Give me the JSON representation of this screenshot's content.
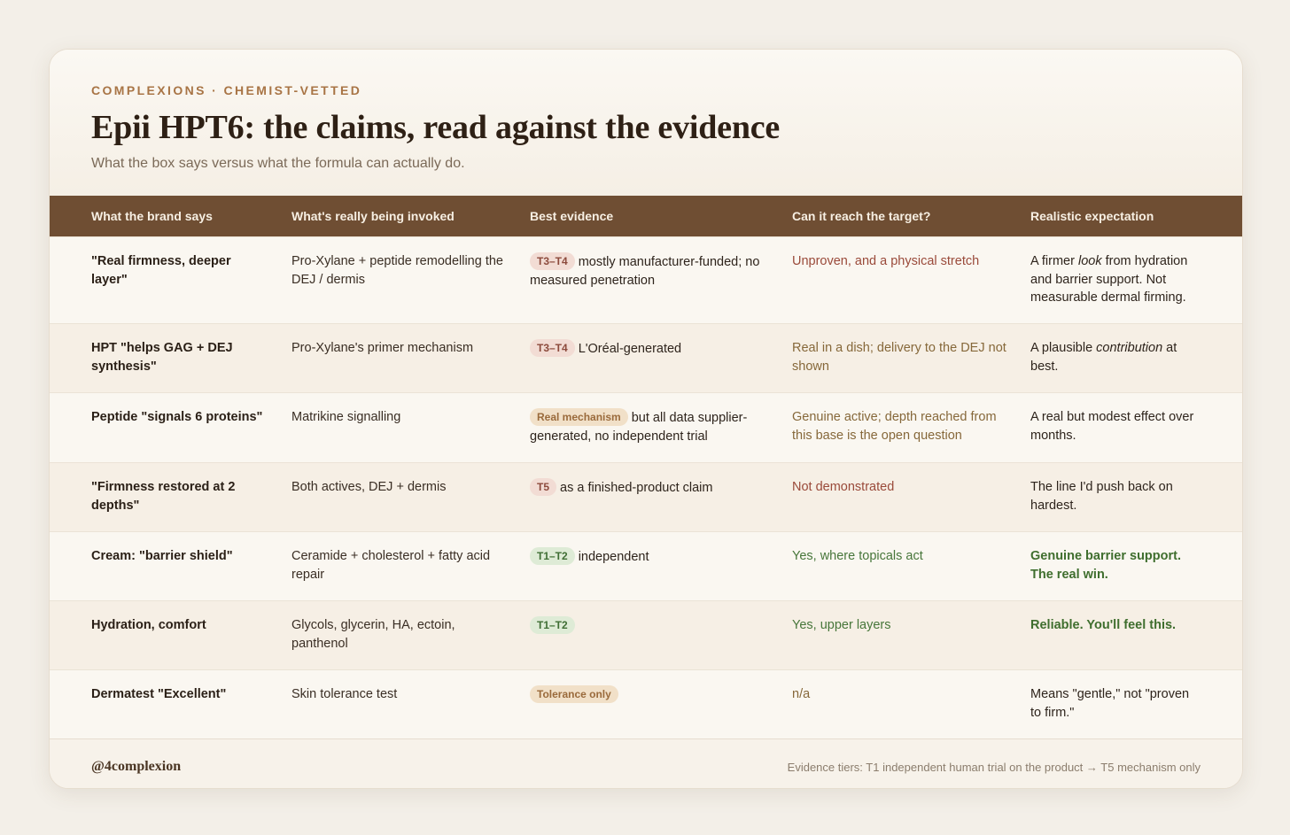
{
  "header": {
    "eyebrow": "COMPLEXIONS · CHEMIST-VETTED",
    "title": "Epii HPT6: the claims, read against the evidence",
    "subtitle": "What the box says versus what the formula can actually do."
  },
  "columns": [
    "What the brand says",
    "What's really being invoked",
    "Best evidence",
    "Can it reach the target?",
    "Realistic expectation"
  ],
  "rows": [
    {
      "claim": "\"Real firmness, deeper layer\"",
      "invoked": "Pro-Xylane + peptide remodelling the DEJ / dermis",
      "badge": "T3–T4",
      "badge_tone": "red",
      "evidence": "mostly manufacturer-funded; no measured penetration",
      "reach": "Unproven, and a physical stretch",
      "reach_tone": "red",
      "expect_parts": [
        "A firmer ",
        "look",
        " from hydration and barrier support. Not measurable dermal firming."
      ],
      "expect_tone": "plain"
    },
    {
      "claim": "HPT \"helps GAG + DEJ synthesis\"",
      "invoked": "Pro-Xylane's primer mechanism",
      "badge": "T3–T4",
      "badge_tone": "red",
      "evidence": "L'Oréal-generated",
      "reach": "Real in a dish; delivery to the DEJ not shown",
      "reach_tone": "olive",
      "expect_parts": [
        "A plausible ",
        "contribution",
        " at best."
      ],
      "expect_tone": "plain"
    },
    {
      "claim": "Peptide \"signals 6 proteins\"",
      "invoked": "Matrikine signalling",
      "badge": "Real mechanism",
      "badge_tone": "tan",
      "evidence": "but all data supplier-generated, no independent trial",
      "reach": "Genuine active; depth reached from this base is the open question",
      "reach_tone": "olive",
      "expect_parts": [
        "A real but modest effect over months.",
        "",
        ""
      ],
      "expect_tone": "plain"
    },
    {
      "claim": "\"Firmness restored at 2 depths\"",
      "invoked": "Both actives, DEJ + dermis",
      "badge": "T5",
      "badge_tone": "red",
      "evidence": "as a finished-product claim",
      "reach": "Not demonstrated",
      "reach_tone": "red",
      "expect_parts": [
        "The line I'd push back on hardest.",
        "",
        ""
      ],
      "expect_tone": "plain"
    },
    {
      "claim": "Cream: \"barrier shield\"",
      "invoked": "Ceramide + cholesterol + fatty acid repair",
      "badge": "T1–T2",
      "badge_tone": "green",
      "evidence": "independent",
      "reach": "Yes, where topicals act",
      "reach_tone": "green",
      "expect_parts": [
        "Genuine barrier support. The real win.",
        "",
        ""
      ],
      "expect_tone": "green"
    },
    {
      "claim": "Hydration, comfort",
      "invoked": "Glycols, glycerin, HA, ectoin, panthenol",
      "badge": "T1–T2",
      "badge_tone": "green",
      "evidence": "",
      "reach": "Yes, upper layers",
      "reach_tone": "green",
      "expect_parts": [
        "Reliable. You'll feel this.",
        "",
        ""
      ],
      "expect_tone": "green"
    },
    {
      "claim": "Dermatest \"Excellent\"",
      "invoked": "Skin tolerance test",
      "badge": "Tolerance only",
      "badge_tone": "tan",
      "evidence": "",
      "reach": "n/a",
      "reach_tone": "olive",
      "expect_parts": [
        "Means \"gentle,\" not \"proven to firm.\"",
        "",
        ""
      ],
      "expect_tone": "plain"
    }
  ],
  "footer": {
    "handle": "@4complexion",
    "legend": "Evidence tiers: T1 independent human trial on the product → T5 mechanism only"
  },
  "colors": {
    "header_bar": "#6f4e33",
    "accent": "#a87445",
    "red_text": "#9a4a3a",
    "green_text": "#47763a",
    "olive_text": "#86683a"
  }
}
